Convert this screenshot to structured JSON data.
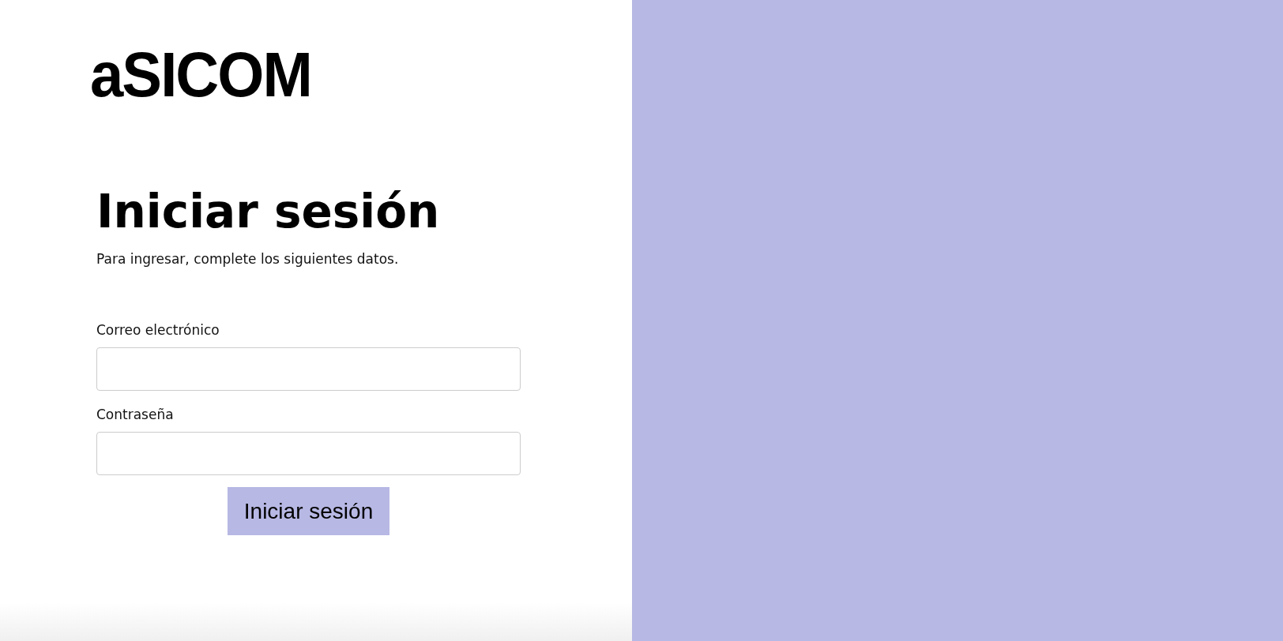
{
  "logo": {
    "text": "aSICOM"
  },
  "heading": "Iniciar sesión",
  "subtitle": "Para ingresar, complete los siguientes datos.",
  "fields": [
    {
      "label": "Correo electrónico"
    },
    {
      "label": "Contraseña"
    }
  ],
  "submit_button": "Iniciar sesión"
}
